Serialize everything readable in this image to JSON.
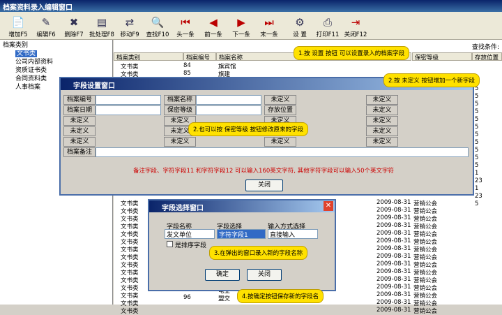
{
  "window_title": "档案资料录入编辑窗口",
  "toolbar": [
    {
      "icon": "add-icon",
      "label": "增加F5"
    },
    {
      "icon": "edit-icon",
      "label": "编辑F6"
    },
    {
      "icon": "delete-icon",
      "label": "删除F7"
    },
    {
      "icon": "batch-icon",
      "label": "批处理F8"
    },
    {
      "icon": "move-icon",
      "label": "移动F9"
    },
    {
      "icon": "search-icon",
      "label": "查找F10"
    },
    {
      "icon": "first-icon",
      "label": "头一条"
    },
    {
      "icon": "prev-icon",
      "label": "前一条"
    },
    {
      "icon": "next-icon",
      "label": "下一条"
    },
    {
      "icon": "last-icon",
      "label": "末一条"
    },
    {
      "icon": "settings-icon",
      "label": "设 置"
    },
    {
      "icon": "print-icon",
      "label": "打印F11"
    },
    {
      "icon": "exit-icon",
      "label": "关闭F12"
    }
  ],
  "tree": {
    "root": "档案类别",
    "items": [
      "文书类",
      "公司内部资料",
      "资质证书类",
      "合同资料类",
      "人事档案"
    ]
  },
  "grid": {
    "search_label": "查找条件:",
    "headers": [
      "档案类别",
      "档案编号",
      "档案名称",
      "保密等级",
      "存放位置"
    ],
    "top_rows": [
      [
        "文书类",
        "84",
        "旗宾馆"
      ],
      [
        "文书类",
        "85",
        "旗建"
      ]
    ],
    "bottom_rows": [
      [
        "文书类",
        "2009-08-31",
        "营销公会",
        "5"
      ],
      [
        "文书类",
        "2009-08-31",
        "营销公会",
        "5"
      ],
      [
        "文书类",
        "2009-08-31",
        "营销公会",
        "5"
      ],
      [
        "文书类",
        "2009-08-31",
        "营销公会",
        "5"
      ],
      [
        "文书类",
        "2009-08-31",
        "营销公会",
        "5"
      ],
      [
        "文书类",
        "2009-08-31",
        "营销公会",
        "5"
      ],
      [
        "文书类",
        "2009-08-31",
        "营销公会",
        "5"
      ],
      [
        "文书类",
        "2009-08-31",
        "营销公会",
        "5"
      ],
      [
        "文书类",
        "2009-08-31",
        "营销公会",
        "5"
      ],
      [
        "文书类",
        "2009-08-31",
        "营销公会",
        "5"
      ],
      [
        "文书类",
        "2009-08-31",
        "营销公会",
        "5"
      ],
      [
        "文书类",
        "2009-08-31",
        "营销公会",
        "5"
      ],
      [
        "文书类",
        "2009-08-31",
        "营销公会",
        "5"
      ],
      [
        "文书类",
        "2009-08-31",
        "营销公会",
        "5"
      ],
      [
        "文书类",
        "2009-08-31",
        "营销公会",
        "5"
      ]
    ],
    "right_col": [
      "5",
      "5",
      "5",
      "5",
      "5",
      "5",
      "5",
      "5",
      "5",
      "5",
      "5",
      "5",
      "1",
      "23",
      "1",
      "23",
      "5"
    ],
    "bottom_extra": [
      [
        "96",
        "电业"
      ],
      [
        "96",
        "盟交"
      ]
    ]
  },
  "field_dialog": {
    "title": "字段设置窗口",
    "row1": [
      "档案编号",
      "档案名称",
      "未定义",
      "未定义"
    ],
    "row2": [
      "档案日期",
      "保密等级",
      "存放位置",
      "未定义"
    ],
    "undef": "未定义",
    "memo_label": "档案备注",
    "note": "备注字段、字符字段11 和字符字段12 可以输入160英文字符, 其他字符字段可以输入50个英文字符",
    "close": "关闭"
  },
  "select_dialog": {
    "title": "字段选择窗口",
    "col1": "字段名称",
    "col2": "字段选择",
    "col3": "输入方式选择",
    "name_value": "发文单位",
    "field_value": "字符字段1",
    "input_value": "直接输入",
    "sort_label": "是排序字段",
    "ok": "确定",
    "close": "关闭"
  },
  "tips": [
    "1.按 设置 按钮 可以设置录入的档案字段",
    "2.按 未定义 按钮增加一个新字段",
    "2.也可以按 保密等级 按钮修改原来的字段",
    "3.在弹出的窗口录入新的字段名称",
    "4.按确定按钮保存新的字段名"
  ]
}
